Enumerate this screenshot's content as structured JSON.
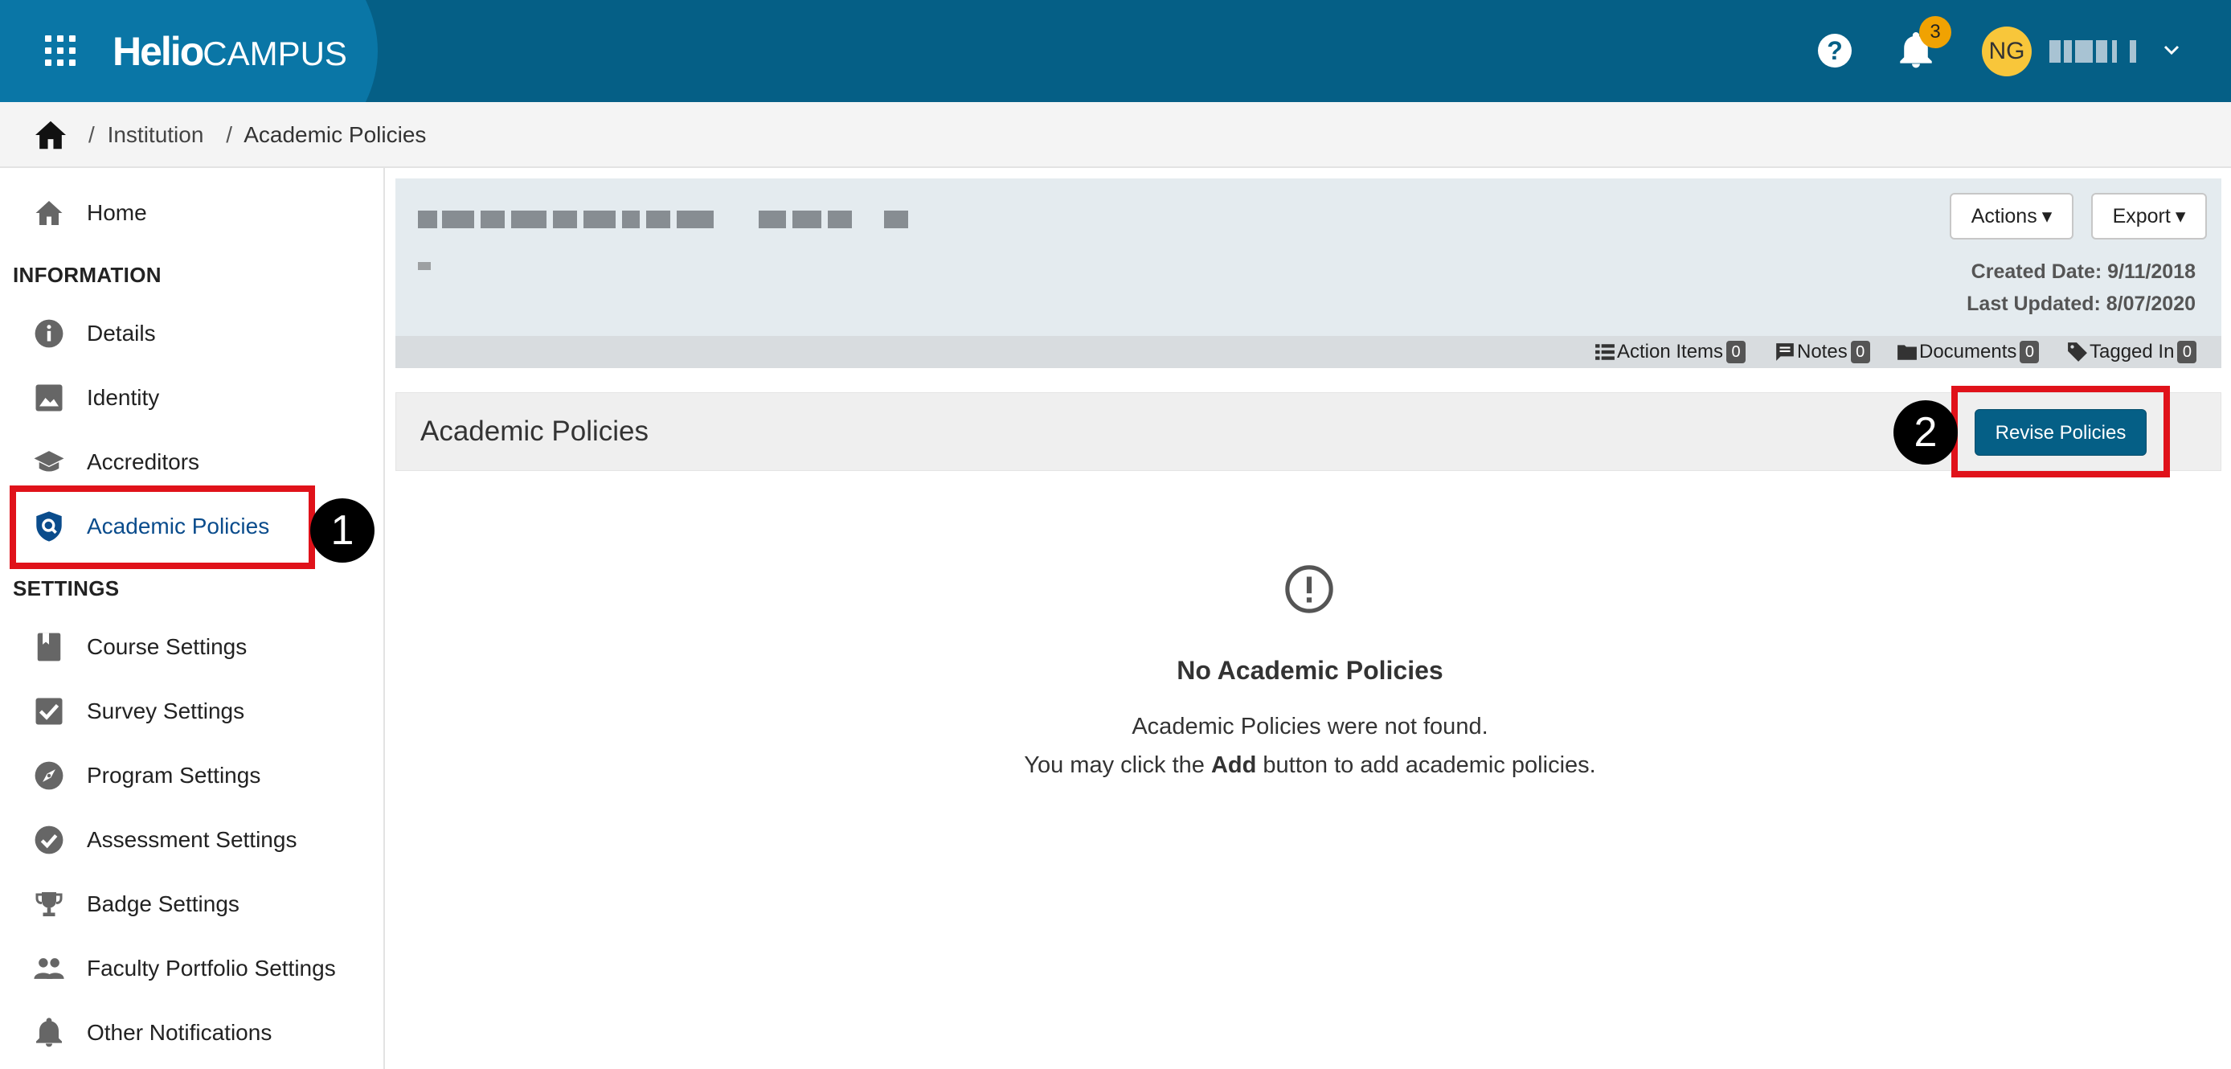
{
  "app": {
    "logo_bold": "Helio",
    "logo_light": "CAMPUS",
    "notification_count": "3",
    "avatar_initials": "NG",
    "brand_color": "#055f86",
    "accent_color": "#f0a202"
  },
  "breadcrumb": {
    "items": [
      "Institution",
      "Academic Policies"
    ],
    "separator": "/"
  },
  "sidebar": {
    "home_label": "Home",
    "section_information": "INFORMATION",
    "info_items": [
      "Details",
      "Identity",
      "Accreditors",
      "Academic Policies"
    ],
    "section_settings": "SETTINGS",
    "settings_items": [
      "Course Settings",
      "Survey Settings",
      "Program Settings",
      "Assessment Settings",
      "Badge Settings",
      "Faculty Portfolio Settings",
      "Other Notifications"
    ],
    "active_item": "Academic Policies"
  },
  "record": {
    "actions_label": "Actions",
    "export_label": "Export",
    "created_date": "Created Date: 9/11/2018",
    "last_updated": "Last Updated: 8/07/2020",
    "counters": [
      {
        "label": "Action Items",
        "count": "0",
        "icon": "list-icon"
      },
      {
        "label": "Notes",
        "count": "0",
        "icon": "notes-icon"
      },
      {
        "label": "Documents",
        "count": "0",
        "icon": "folder-icon"
      },
      {
        "label": "Tagged In",
        "count": "0",
        "icon": "tag-icon"
      }
    ]
  },
  "section": {
    "title": "Academic Policies",
    "revise_button": "Revise Policies"
  },
  "empty_state": {
    "title": "No Academic Policies",
    "message": "Academic Policies were not found.",
    "hint_prefix": "You may click the ",
    "hint_bold": "Add",
    "hint_suffix": " button to add academic policies."
  },
  "annotations": {
    "step1": "1",
    "step2": "2",
    "highlight_color": "#e0121a"
  }
}
